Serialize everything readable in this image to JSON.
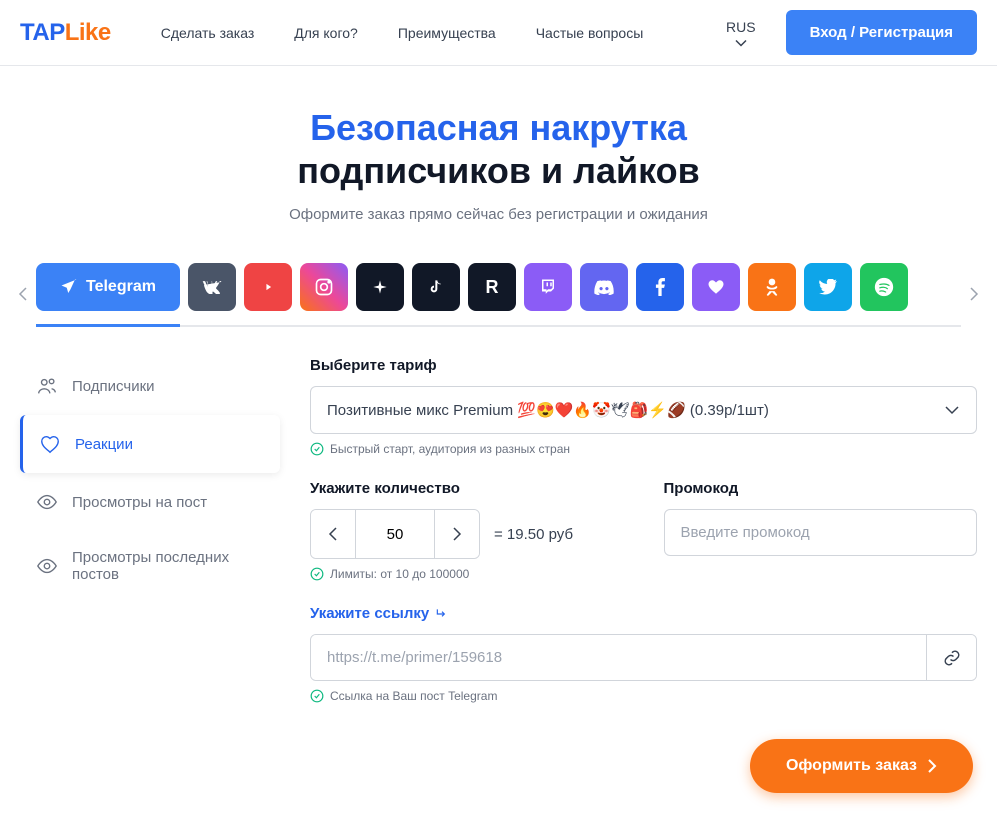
{
  "logo": {
    "tap": "TAP",
    "like": "Like"
  },
  "nav": [
    "Сделать заказ",
    "Для кого?",
    "Преимущества",
    "Частые вопросы"
  ],
  "lang": "RUS",
  "login": "Вход / Регистрация",
  "hero": {
    "title1": "Безопасная накрутка",
    "title2": "подписчиков и лайков",
    "sub": "Оформите заказ прямо сейчас без регистрации и ожидания"
  },
  "platforms": {
    "active": "Telegram"
  },
  "sidebar": [
    {
      "label": "Подписчики",
      "icon": "users"
    },
    {
      "label": "Реакции",
      "icon": "heart",
      "active": true
    },
    {
      "label": "Просмотры на пост",
      "icon": "eye"
    },
    {
      "label": "Просмотры последних постов",
      "icon": "eye"
    }
  ],
  "form": {
    "tariff_label": "Выберите тариф",
    "tariff_value": "Позитивные микс Premium 💯😍❤️🔥🤡🕊🎒⚡🏈 (0.39р/1шт)",
    "tariff_hint": "Быстрый старт, аудитория из разных стран",
    "qty_label": "Укажите количество",
    "qty_value": "50",
    "price": "= 19.50 руб",
    "qty_hint": "Лимиты: от 10 до 100000",
    "promo_label": "Промокод",
    "promo_placeholder": "Введите промокод",
    "link_label": "Укажите ссылку",
    "link_placeholder": "https://t.me/primer/159618",
    "link_hint": "Ссылка на Ваш пост Telegram"
  },
  "submit": "Оформить заказ"
}
